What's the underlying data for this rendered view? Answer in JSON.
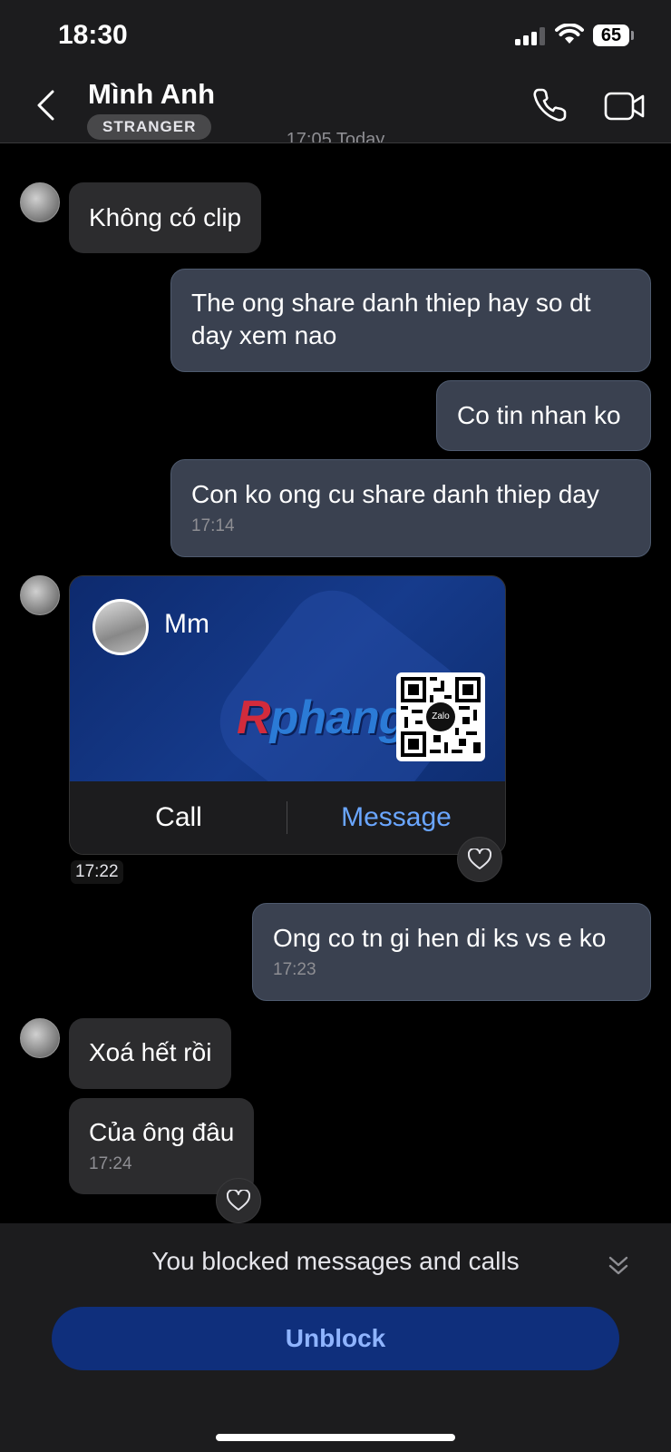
{
  "status_bar": {
    "time": "18:30",
    "battery": "65"
  },
  "header": {
    "contact_name": "Mình Anh",
    "badge": "STRANGER"
  },
  "date_separator": "17:05 Today",
  "messages": [
    {
      "dir": "in",
      "text": "Không có clip"
    },
    {
      "dir": "out",
      "text": "The ong share danh thiep hay so dt day xem nao"
    },
    {
      "dir": "out",
      "text": "Co tin nhan ko"
    },
    {
      "dir": "out",
      "text": "Con ko ong cu share danh thiep day",
      "time": "17:14"
    },
    {
      "dir": "out",
      "text": "Ong co tn gi hen di ks vs e ko",
      "time": "17:23"
    },
    {
      "dir": "in",
      "text": "Xoá hết rồi"
    },
    {
      "dir": "in",
      "text": "Của ông đâu",
      "time": "17:24"
    }
  ],
  "contact_card": {
    "name": "Mm",
    "watermark": "Rphang",
    "qr_label": "Zalo",
    "call_label": "Call",
    "message_label": "Message",
    "time": "17:22"
  },
  "footer": {
    "blocked_text": "You blocked messages and calls",
    "unblock_label": "Unblock"
  },
  "colors": {
    "outgoing_bubble": "#3a4150",
    "incoming_bubble": "#2c2c2e",
    "accent": "#6aa6ff",
    "unblock_bg": "#0f2f7c"
  }
}
